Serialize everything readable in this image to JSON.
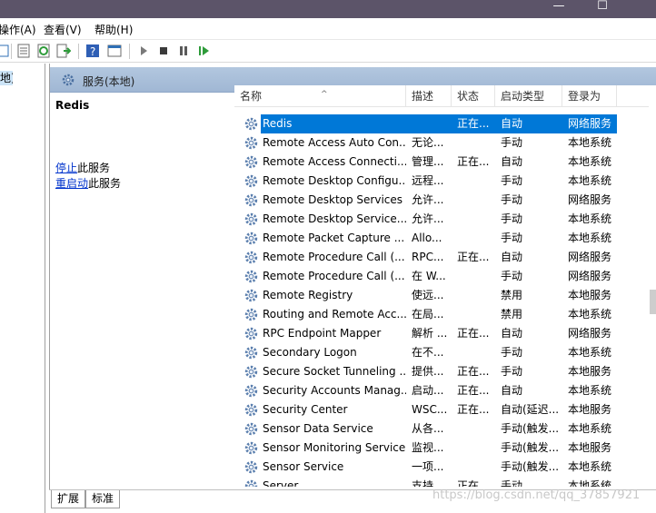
{
  "window": {
    "controls": {
      "minimize": "—",
      "maximize": "☐"
    }
  },
  "menu": {
    "items": [
      "操作(A)",
      "查看(V)",
      "帮助(H)"
    ]
  },
  "left_tree": {
    "label": "地)"
  },
  "header": {
    "title": "服务(本地)"
  },
  "description": {
    "service_name": "Redis",
    "stop_link": "停止",
    "stop_rest": "此服务",
    "restart_link": "重启动",
    "restart_rest": "此服务"
  },
  "columns": {
    "name": "名称",
    "desc": "描述",
    "status": "状态",
    "startup": "启动类型",
    "logon": "登录为"
  },
  "services": [
    {
      "name": "Redis",
      "desc": "",
      "status": "正在...",
      "startup": "自动",
      "logon": "网络服务",
      "selected": true
    },
    {
      "name": "Remote Access Auto Con...",
      "desc": "无论...",
      "status": "",
      "startup": "手动",
      "logon": "本地系统"
    },
    {
      "name": "Remote Access Connecti...",
      "desc": "管理...",
      "status": "正在...",
      "startup": "自动",
      "logon": "本地系统"
    },
    {
      "name": "Remote Desktop Configu...",
      "desc": "远程...",
      "status": "",
      "startup": "手动",
      "logon": "本地系统"
    },
    {
      "name": "Remote Desktop Services",
      "desc": "允许...",
      "status": "",
      "startup": "手动",
      "logon": "网络服务"
    },
    {
      "name": "Remote Desktop Service...",
      "desc": "允许...",
      "status": "",
      "startup": "手动",
      "logon": "本地系统"
    },
    {
      "name": "Remote Packet Capture ...",
      "desc": "Allo...",
      "status": "",
      "startup": "手动",
      "logon": "本地系统"
    },
    {
      "name": "Remote Procedure Call (...",
      "desc": "RPC...",
      "status": "正在...",
      "startup": "自动",
      "logon": "网络服务"
    },
    {
      "name": "Remote Procedure Call (...",
      "desc": "在 W...",
      "status": "",
      "startup": "手动",
      "logon": "网络服务"
    },
    {
      "name": "Remote Registry",
      "desc": "使远...",
      "status": "",
      "startup": "禁用",
      "logon": "本地服务"
    },
    {
      "name": "Routing and Remote Acc...",
      "desc": "在局...",
      "status": "",
      "startup": "禁用",
      "logon": "本地系统"
    },
    {
      "name": "RPC Endpoint Mapper",
      "desc": "解析 ...",
      "status": "正在...",
      "startup": "自动",
      "logon": "网络服务"
    },
    {
      "name": "Secondary Logon",
      "desc": "在不...",
      "status": "",
      "startup": "手动",
      "logon": "本地系统"
    },
    {
      "name": "Secure Socket Tunneling ...",
      "desc": "提供...",
      "status": "正在...",
      "startup": "手动",
      "logon": "本地服务"
    },
    {
      "name": "Security Accounts Manag...",
      "desc": "启动...",
      "status": "正在...",
      "startup": "自动",
      "logon": "本地系统"
    },
    {
      "name": "Security Center",
      "desc": "WSC...",
      "status": "正在...",
      "startup": "自动(延迟...",
      "logon": "本地服务"
    },
    {
      "name": "Sensor Data Service",
      "desc": "从各...",
      "status": "",
      "startup": "手动(触发...",
      "logon": "本地系统"
    },
    {
      "name": "Sensor Monitoring Service",
      "desc": "监视...",
      "status": "",
      "startup": "手动(触发...",
      "logon": "本地服务"
    },
    {
      "name": "Sensor Service",
      "desc": "一项...",
      "status": "",
      "startup": "手动(触发...",
      "logon": "本地系统"
    },
    {
      "name": "Server",
      "desc": "支持...",
      "status": "正在...",
      "startup": "手动",
      "logon": "本地系统"
    }
  ],
  "tabs": [
    "扩展",
    "标准"
  ],
  "watermark": "https://blog.csdn.net/qq_37857921",
  "colors": {
    "selection": "#0078d7",
    "header": "#a9bfdb",
    "link": "#0033cc"
  }
}
